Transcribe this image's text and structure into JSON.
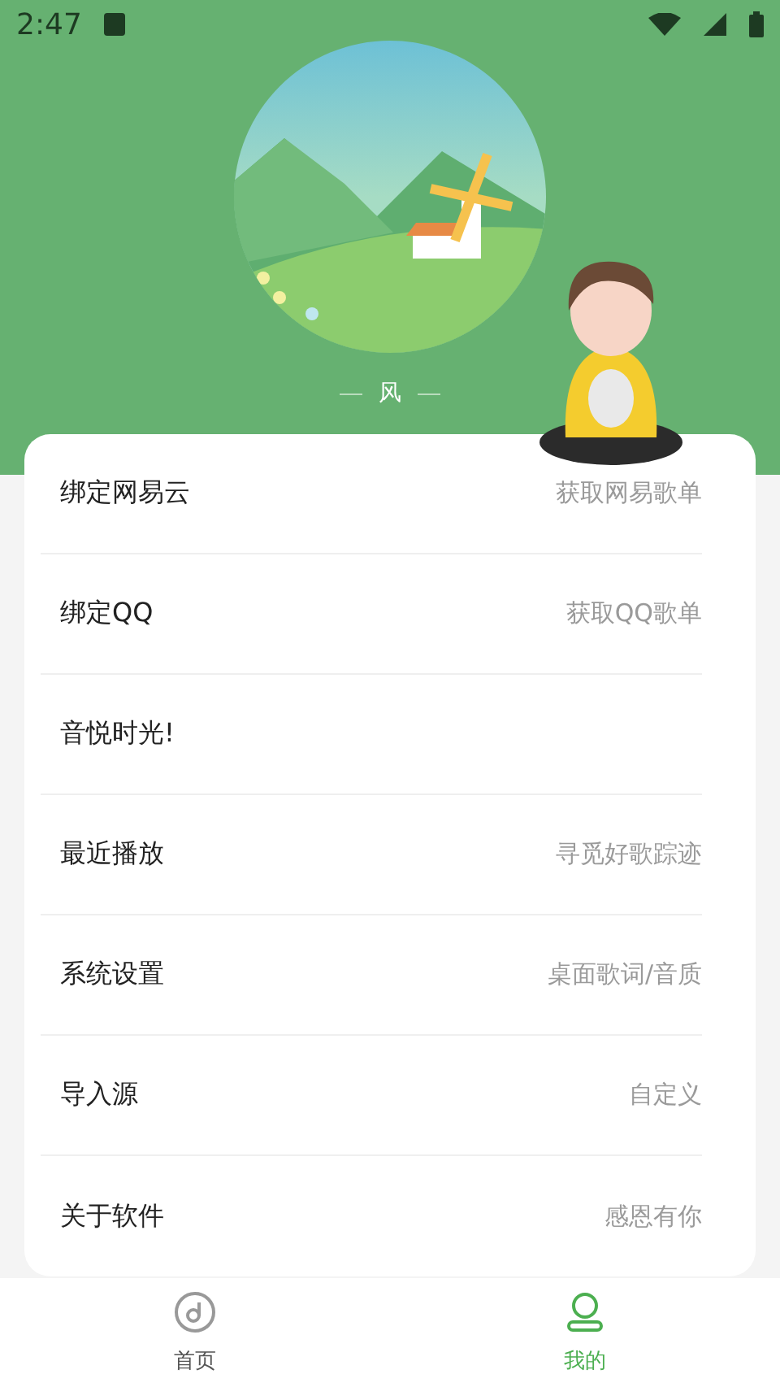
{
  "status_bar": {
    "time": "2:47"
  },
  "profile": {
    "name": "风"
  },
  "menu": [
    {
      "label": "绑定网易云",
      "hint": "获取网易歌单"
    },
    {
      "label": "绑定QQ",
      "hint": "获取QQ歌单"
    },
    {
      "label": "音悦时光!"
    },
    {
      "label": "最近播放",
      "hint": "寻觅好歌踪迹"
    },
    {
      "label": "系统设置",
      "hint": "桌面歌词/音质"
    },
    {
      "label": "导入源",
      "hint": "自定义"
    },
    {
      "label": "关于软件",
      "hint": "感恩有你"
    }
  ],
  "tabs": [
    {
      "label": "首页",
      "kind": "disc",
      "selected": false
    },
    {
      "label": "我的",
      "kind": "person",
      "selected": true
    }
  ]
}
